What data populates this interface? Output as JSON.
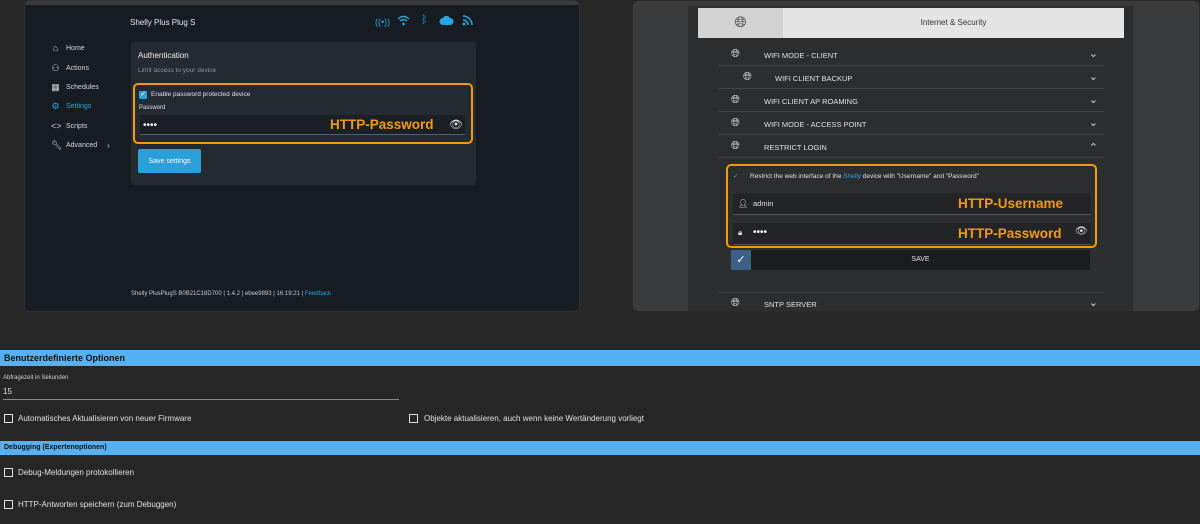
{
  "left": {
    "app_title": "Shelly Plus Plug S",
    "status_icons": [
      "radio-signal-icon",
      "wifi-icon",
      "bluetooth-icon",
      "cloud-icon",
      "rss-icon"
    ],
    "nav": [
      {
        "label": "Home",
        "icon": "home-icon"
      },
      {
        "label": "Actions",
        "icon": "actions-icon"
      },
      {
        "label": "Schedules",
        "icon": "calendar-icon"
      },
      {
        "label": "Settings",
        "icon": "gear-icon",
        "active": true
      },
      {
        "label": "Scripts",
        "icon": "code-icon"
      },
      {
        "label": "Advanced",
        "icon": "wrench-icon"
      }
    ],
    "card": {
      "title": "Authentication",
      "subtitle": "Limit access to your device",
      "checkbox_label": "Enable password protected device",
      "password_label": "Password",
      "password_value": "••••",
      "annotation": "HTTP-Password",
      "save_label": "Save settings"
    },
    "footer": {
      "device": "Shelly PlusPlugS B0B21C18D700",
      "version": "1.4.2",
      "hash": "ebee9893",
      "time": "16:19:21",
      "feedback": "Feedback"
    }
  },
  "right": {
    "header": "Internet & Security",
    "rows": [
      "WIFI MODE - CLIENT",
      "WIFI CLIENT BACKUP",
      "WIFI CLIENT AP ROAMING",
      "WIFI MODE - ACCESS POINT",
      "RESTRICT LOGIN"
    ],
    "restrict": {
      "text_before": "Restrict the web interface of the ",
      "brand": "Shelly",
      "text_after": " device with \"Username\" and \"Password\"",
      "username": "admin",
      "password": "••••",
      "annotation_user": "HTTP-Username",
      "annotation_pass": "HTTP-Password"
    },
    "save_label": "SAVE",
    "last_row": "SNTP SERVER"
  },
  "bottom": {
    "section1": "Benutzerdefinierte Optionen",
    "poll_label": "Abfragezeit in Sekunden",
    "poll_value": "15",
    "opt_firmware": "Automatisches Aktualisieren von neuer Firmware",
    "opt_objects": "Objekte aktualisieren, auch wenn keine Wertänderung vorliegt",
    "section2": "Debugging (Expertenoptionen)",
    "opt_debug": "Debug-Meldungen protokollieren",
    "opt_http": "HTTP-Antworten speichern (zum Debuggen)"
  },
  "colors": {
    "accent_blue": "#2ca3e0",
    "highlight_orange": "#f59a0c",
    "section_bar": "#55b1f2"
  }
}
